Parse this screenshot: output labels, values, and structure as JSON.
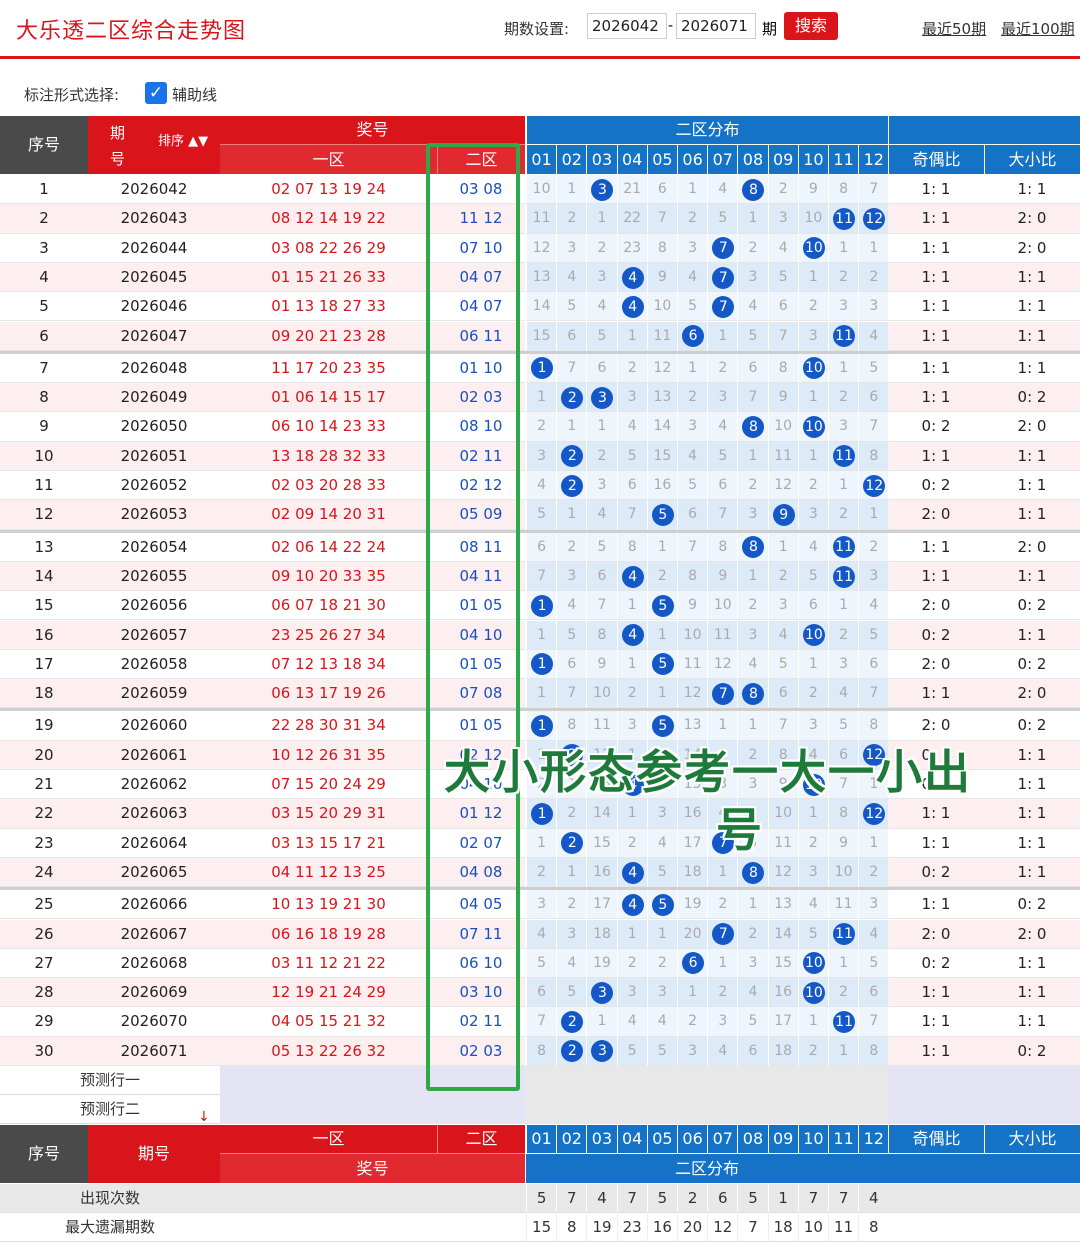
{
  "header": {
    "title": "大乐透二区综合走势图",
    "period_label": "期数设置:",
    "period_start": "2026042",
    "period_sep": "-",
    "period_end": "2026071",
    "period_unit": "期",
    "search_label": "搜索",
    "link_50": "最近50期",
    "link_100": "最近100期"
  },
  "options": {
    "label": "标注形式选择:",
    "aux_checked": true,
    "aux_label": "辅助线"
  },
  "table_head": {
    "seq": "序号",
    "period": "期号",
    "sort": "排序",
    "prize": "奖号",
    "zone1": "一区",
    "zone2": "二区",
    "dist": "二区分布",
    "numbers": [
      "01",
      "02",
      "03",
      "04",
      "05",
      "06",
      "07",
      "08",
      "09",
      "10",
      "11",
      "12"
    ],
    "odd_even": "奇偶比",
    "big_small": "大小比"
  },
  "rows": [
    {
      "seq": "1",
      "period": "2026042",
      "z1": "02 07 13 19 24",
      "z2": "03 08",
      "dist": [
        "10",
        "1",
        "3",
        "21",
        "6",
        "1",
        "4",
        "8",
        "2",
        "9",
        "8",
        "7"
      ],
      "hits": [
        3,
        8
      ],
      "oe": "1: 1",
      "bs": "1: 1"
    },
    {
      "seq": "2",
      "period": "2026043",
      "z1": "08 12 14 19 22",
      "z2": "11 12",
      "dist": [
        "11",
        "2",
        "1",
        "22",
        "7",
        "2",
        "5",
        "1",
        "3",
        "10",
        "11",
        "12"
      ],
      "hits": [
        11,
        12
      ],
      "oe": "1: 1",
      "bs": "2: 0"
    },
    {
      "seq": "3",
      "period": "2026044",
      "z1": "03 08 22 26 29",
      "z2": "07 10",
      "dist": [
        "12",
        "3",
        "2",
        "23",
        "8",
        "3",
        "7",
        "2",
        "4",
        "10",
        "1",
        "1"
      ],
      "hits": [
        7,
        10
      ],
      "oe": "1: 1",
      "bs": "2: 0"
    },
    {
      "seq": "4",
      "period": "2026045",
      "z1": "01 15 21 26 33",
      "z2": "04 07",
      "dist": [
        "13",
        "4",
        "3",
        "4",
        "9",
        "4",
        "7",
        "3",
        "5",
        "1",
        "2",
        "2"
      ],
      "hits": [
        4,
        7
      ],
      "oe": "1: 1",
      "bs": "1: 1"
    },
    {
      "seq": "5",
      "period": "2026046",
      "z1": "01 13 18 27 33",
      "z2": "04 07",
      "dist": [
        "14",
        "5",
        "4",
        "4",
        "10",
        "5",
        "7",
        "4",
        "6",
        "2",
        "3",
        "3"
      ],
      "hits": [
        4,
        7
      ],
      "oe": "1: 1",
      "bs": "1: 1"
    },
    {
      "seq": "6",
      "period": "2026047",
      "z1": "09 20 21 23 28",
      "z2": "06 11",
      "dist": [
        "15",
        "6",
        "5",
        "1",
        "11",
        "6",
        "1",
        "5",
        "7",
        "3",
        "11",
        "4"
      ],
      "hits": [
        6,
        11
      ],
      "oe": "1: 1",
      "bs": "1: 1"
    },
    {
      "seq": "7",
      "period": "2026048",
      "z1": "11 17 20 23 35",
      "z2": "01 10",
      "dist": [
        "1",
        "7",
        "6",
        "2",
        "12",
        "1",
        "2",
        "6",
        "8",
        "10",
        "1",
        "5"
      ],
      "hits": [
        1,
        10
      ],
      "oe": "1: 1",
      "bs": "1: 1"
    },
    {
      "seq": "8",
      "period": "2026049",
      "z1": "01 06 14 15 17",
      "z2": "02 03",
      "dist": [
        "1",
        "2",
        "3",
        "3",
        "13",
        "2",
        "3",
        "7",
        "9",
        "1",
        "2",
        "6"
      ],
      "hits": [
        2,
        3
      ],
      "oe": "1: 1",
      "bs": "0: 2"
    },
    {
      "seq": "9",
      "period": "2026050",
      "z1": "06 10 14 23 33",
      "z2": "08 10",
      "dist": [
        "2",
        "1",
        "1",
        "4",
        "14",
        "3",
        "4",
        "8",
        "10",
        "10",
        "3",
        "7"
      ],
      "hits": [
        8,
        10
      ],
      "oe": "0: 2",
      "bs": "2: 0"
    },
    {
      "seq": "10",
      "period": "2026051",
      "z1": "13 18 28 32 33",
      "z2": "02 11",
      "dist": [
        "3",
        "2",
        "2",
        "5",
        "15",
        "4",
        "5",
        "1",
        "11",
        "1",
        "11",
        "8"
      ],
      "hits": [
        2,
        11
      ],
      "oe": "1: 1",
      "bs": "1: 1"
    },
    {
      "seq": "11",
      "period": "2026052",
      "z1": "02 03 20 28 33",
      "z2": "02 12",
      "dist": [
        "4",
        "2",
        "3",
        "6",
        "16",
        "5",
        "6",
        "2",
        "12",
        "2",
        "1",
        "12"
      ],
      "hits": [
        2,
        12
      ],
      "oe": "0: 2",
      "bs": "1: 1"
    },
    {
      "seq": "12",
      "period": "2026053",
      "z1": "02 09 14 20 31",
      "z2": "05 09",
      "dist": [
        "5",
        "1",
        "4",
        "7",
        "5",
        "6",
        "7",
        "3",
        "9",
        "3",
        "2",
        "1"
      ],
      "hits": [
        5,
        9
      ],
      "oe": "2: 0",
      "bs": "1: 1"
    },
    {
      "seq": "13",
      "period": "2026054",
      "z1": "02 06 14 22 24",
      "z2": "08 11",
      "dist": [
        "6",
        "2",
        "5",
        "8",
        "1",
        "7",
        "8",
        "8",
        "1",
        "4",
        "11",
        "2"
      ],
      "hits": [
        8,
        11
      ],
      "oe": "1: 1",
      "bs": "2: 0"
    },
    {
      "seq": "14",
      "period": "2026055",
      "z1": "09 10 20 33 35",
      "z2": "04 11",
      "dist": [
        "7",
        "3",
        "6",
        "4",
        "2",
        "8",
        "9",
        "1",
        "2",
        "5",
        "11",
        "3"
      ],
      "hits": [
        4,
        11
      ],
      "oe": "1: 1",
      "bs": "1: 1"
    },
    {
      "seq": "15",
      "period": "2026056",
      "z1": "06 07 18 21 30",
      "z2": "01 05",
      "dist": [
        "1",
        "4",
        "7",
        "1",
        "5",
        "9",
        "10",
        "2",
        "3",
        "6",
        "1",
        "4"
      ],
      "hits": [
        1,
        5
      ],
      "oe": "2: 0",
      "bs": "0: 2"
    },
    {
      "seq": "16",
      "period": "2026057",
      "z1": "23 25 26 27 34",
      "z2": "04 10",
      "dist": [
        "1",
        "5",
        "8",
        "4",
        "1",
        "10",
        "11",
        "3",
        "4",
        "10",
        "2",
        "5"
      ],
      "hits": [
        4,
        10
      ],
      "oe": "0: 2",
      "bs": "1: 1"
    },
    {
      "seq": "17",
      "period": "2026058",
      "z1": "07 12 13 18 34",
      "z2": "01 05",
      "dist": [
        "1",
        "6",
        "9",
        "1",
        "5",
        "11",
        "12",
        "4",
        "5",
        "1",
        "3",
        "6"
      ],
      "hits": [
        1,
        5
      ],
      "oe": "2: 0",
      "bs": "0: 2"
    },
    {
      "seq": "18",
      "period": "2026059",
      "z1": "06 13 17 19 26",
      "z2": "07 08",
      "dist": [
        "1",
        "7",
        "10",
        "2",
        "1",
        "12",
        "7",
        "8",
        "6",
        "2",
        "4",
        "7"
      ],
      "hits": [
        7,
        8
      ],
      "oe": "1: 1",
      "bs": "2: 0"
    },
    {
      "seq": "19",
      "period": "2026060",
      "z1": "22 28 30 31 34",
      "z2": "01 05",
      "dist": [
        "1",
        "8",
        "11",
        "3",
        "5",
        "13",
        "1",
        "1",
        "7",
        "3",
        "5",
        "8"
      ],
      "hits": [
        1,
        5
      ],
      "oe": "2: 0",
      "bs": "0: 2"
    },
    {
      "seq": "20",
      "period": "2026061",
      "z1": "10 12 26 31 35",
      "z2": "02 12",
      "dist": [
        "1",
        "2",
        "12",
        "1",
        "1",
        "14",
        "2",
        "2",
        "8",
        "4",
        "6",
        "12"
      ],
      "hits": [
        2,
        12
      ],
      "oe": "0: 2",
      "bs": "1: 1"
    },
    {
      "seq": "21",
      "period": "2026062",
      "z1": "07 15 20 24 29",
      "z2": "04 10",
      "dist": [
        "2",
        "1",
        "13",
        "4",
        "2",
        "15",
        "3",
        "3",
        "9",
        "10",
        "7",
        "1"
      ],
      "hits": [
        4,
        10
      ],
      "oe": "0: 2",
      "bs": "1: 1"
    },
    {
      "seq": "22",
      "period": "2026063",
      "z1": "03 15 20 29 31",
      "z2": "01 12",
      "dist": [
        "1",
        "2",
        "14",
        "1",
        "3",
        "16",
        "4",
        "4",
        "10",
        "1",
        "8",
        "12"
      ],
      "hits": [
        1,
        12
      ],
      "oe": "1: 1",
      "bs": "1: 1"
    },
    {
      "seq": "23",
      "period": "2026064",
      "z1": "03 13 15 17 21",
      "z2": "02 07",
      "dist": [
        "1",
        "2",
        "15",
        "2",
        "4",
        "17",
        "7",
        "5",
        "11",
        "2",
        "9",
        "1"
      ],
      "hits": [
        2,
        7
      ],
      "oe": "1: 1",
      "bs": "1: 1"
    },
    {
      "seq": "24",
      "period": "2026065",
      "z1": "04 11 12 13 25",
      "z2": "04 08",
      "dist": [
        "2",
        "1",
        "16",
        "4",
        "5",
        "18",
        "1",
        "8",
        "12",
        "3",
        "10",
        "2"
      ],
      "hits": [
        4,
        8
      ],
      "oe": "0: 2",
      "bs": "1: 1"
    },
    {
      "seq": "25",
      "period": "2026066",
      "z1": "10 13 19 21 30",
      "z2": "04 05",
      "dist": [
        "3",
        "2",
        "17",
        "4",
        "5",
        "19",
        "2",
        "1",
        "13",
        "4",
        "11",
        "3"
      ],
      "hits": [
        4,
        5
      ],
      "oe": "1: 1",
      "bs": "0: 2"
    },
    {
      "seq": "26",
      "period": "2026067",
      "z1": "06 16 18 19 28",
      "z2": "07 11",
      "dist": [
        "4",
        "3",
        "18",
        "1",
        "1",
        "20",
        "7",
        "2",
        "14",
        "5",
        "11",
        "4"
      ],
      "hits": [
        7,
        11
      ],
      "oe": "2: 0",
      "bs": "2: 0"
    },
    {
      "seq": "27",
      "period": "2026068",
      "z1": "03 11 12 21 22",
      "z2": "06 10",
      "dist": [
        "5",
        "4",
        "19",
        "2",
        "2",
        "6",
        "1",
        "3",
        "15",
        "10",
        "1",
        "5"
      ],
      "hits": [
        6,
        10
      ],
      "oe": "0: 2",
      "bs": "1: 1"
    },
    {
      "seq": "28",
      "period": "2026069",
      "z1": "12 19 21 24 29",
      "z2": "03 10",
      "dist": [
        "6",
        "5",
        "3",
        "3",
        "3",
        "1",
        "2",
        "4",
        "16",
        "10",
        "2",
        "6"
      ],
      "hits": [
        3,
        10
      ],
      "oe": "1: 1",
      "bs": "1: 1"
    },
    {
      "seq": "29",
      "period": "2026070",
      "z1": "04 05 15 21 32",
      "z2": "02 11",
      "dist": [
        "7",
        "2",
        "1",
        "4",
        "4",
        "2",
        "3",
        "5",
        "17",
        "1",
        "11",
        "7"
      ],
      "hits": [
        2,
        11
      ],
      "oe": "1: 1",
      "bs": "1: 1"
    },
    {
      "seq": "30",
      "period": "2026071",
      "z1": "05 13 22 26 32",
      "z2": "02 03",
      "dist": [
        "8",
        "2",
        "3",
        "5",
        "5",
        "3",
        "4",
        "6",
        "18",
        "2",
        "1",
        "8"
      ],
      "hits": [
        2,
        3
      ],
      "oe": "1: 1",
      "bs": "0: 2"
    }
  ],
  "predict": {
    "row1": "预测行一",
    "row2": "预测行二"
  },
  "footer": {
    "appear_label": "出现次数",
    "appear": [
      "5",
      "7",
      "4",
      "7",
      "5",
      "2",
      "6",
      "5",
      "1",
      "7",
      "7",
      "4"
    ],
    "maxmiss_label": "最大遗漏期数",
    "maxmiss": [
      "15",
      "8",
      "19",
      "23",
      "16",
      "20",
      "12",
      "7",
      "18",
      "10",
      "11",
      "8"
    ]
  },
  "overlay": {
    "line1": "大小形态参考一大一小出",
    "line2": "号"
  },
  "colors": {
    "red": "#d9141a",
    "blue": "#1473c6",
    "ball": "#1458c8",
    "green": "#2ea84a"
  }
}
